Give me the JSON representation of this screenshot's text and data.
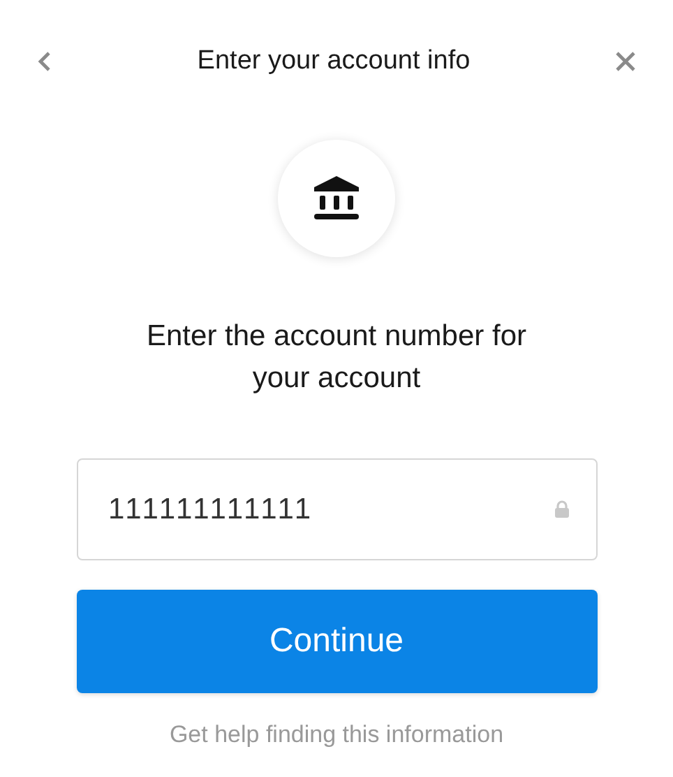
{
  "header": {
    "title": "Enter your account info"
  },
  "heading": "Enter the account number for your account",
  "account_field": {
    "value": "111111111111",
    "locked": true
  },
  "continue_button": "Continue",
  "help_link": "Get help finding this information"
}
